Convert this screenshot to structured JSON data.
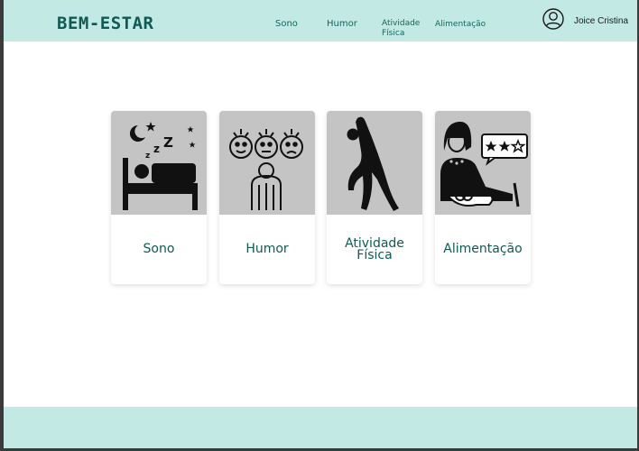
{
  "header": {
    "brand": "BEM-ESTAR",
    "nav": [
      {
        "label": "Sono"
      },
      {
        "label": "Humor"
      },
      {
        "label": "Atividade Física"
      },
      {
        "label": "Alimentação"
      }
    ],
    "user": {
      "name": "Joice Cristina",
      "icon": "user-circle-icon"
    }
  },
  "cards": [
    {
      "label": "Sono",
      "icon": "sleep-icon"
    },
    {
      "label": "Humor",
      "icon": "mood-faces-icon"
    },
    {
      "label": "Atividade Física",
      "icon": "stretching-person-icon"
    },
    {
      "label": "Alimentação",
      "icon": "eating-review-icon"
    }
  ],
  "colors": {
    "header_bg": "#c3e9e4",
    "brand": "#0f5a55",
    "card_image_bg": "#c4c4c4"
  }
}
